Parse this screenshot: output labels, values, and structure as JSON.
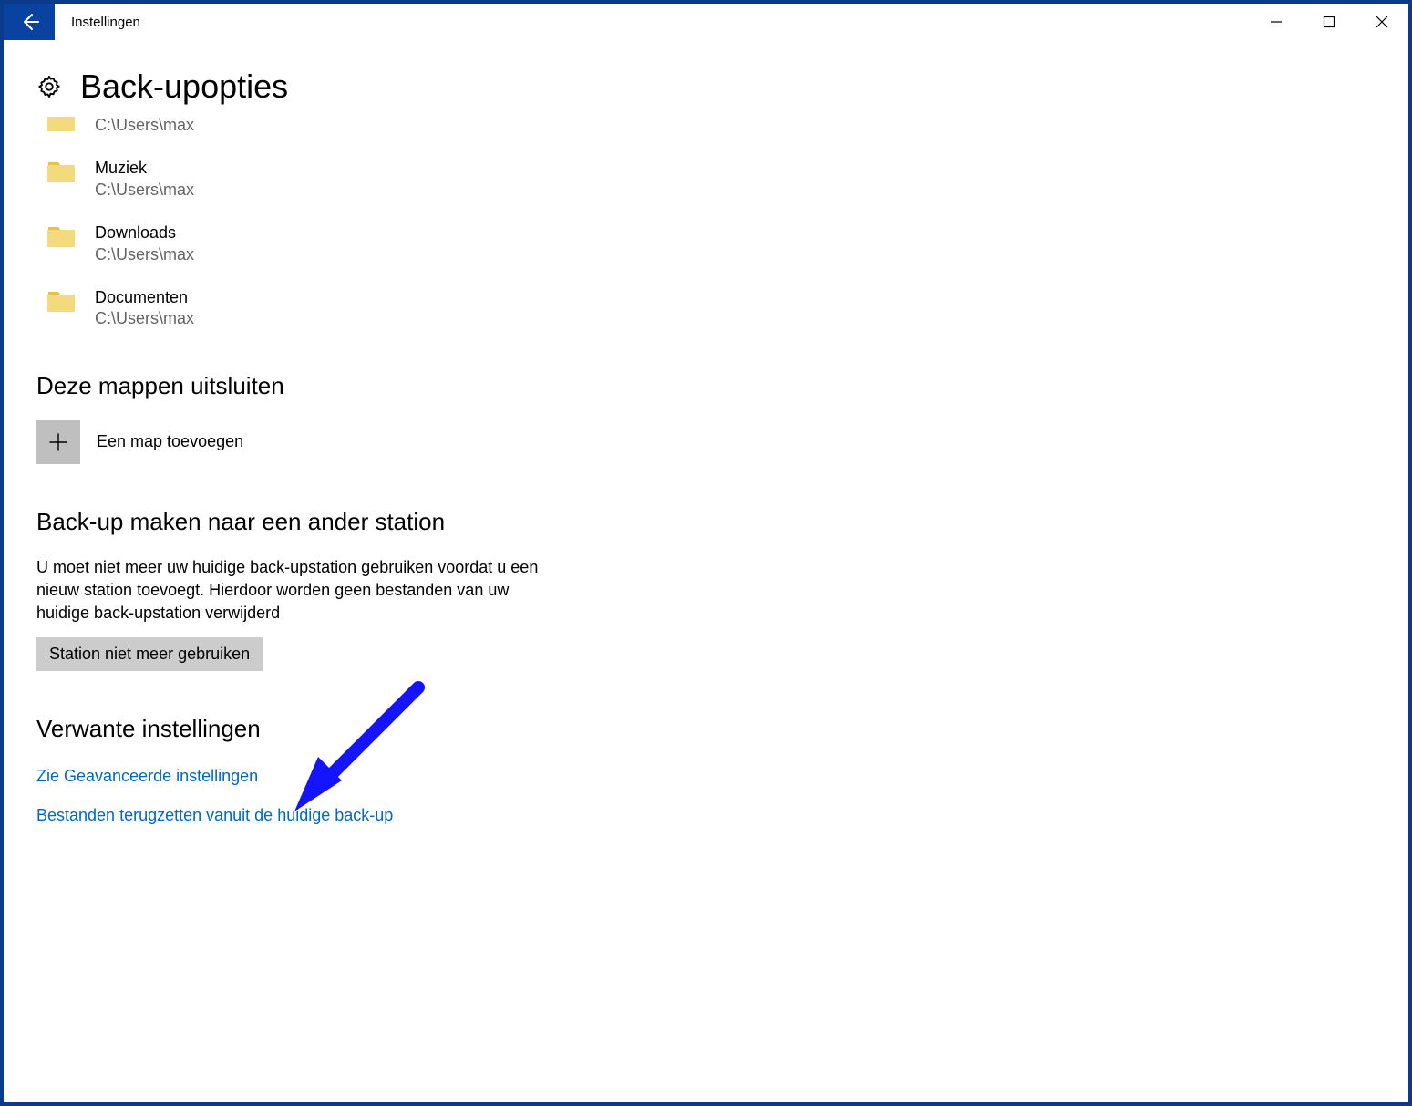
{
  "window": {
    "title": "Instellingen"
  },
  "page": {
    "title": "Back-upopties"
  },
  "folders": [
    {
      "name": "",
      "path": "C:\\Users\\max"
    },
    {
      "name": "Muziek",
      "path": "C:\\Users\\max"
    },
    {
      "name": "Downloads",
      "path": "C:\\Users\\max"
    },
    {
      "name": "Documenten",
      "path": "C:\\Users\\max"
    }
  ],
  "exclude": {
    "heading": "Deze mappen uitsluiten",
    "addLabel": "Een map toevoegen"
  },
  "otherDrive": {
    "heading": "Back-up maken naar een ander station",
    "description": "U moet niet meer uw huidige back-upstation gebruiken voordat u een nieuw station toevoegt. Hierdoor worden geen bestanden van uw huidige back-upstation verwijderd",
    "button": "Station niet meer gebruiken"
  },
  "related": {
    "heading": "Verwante instellingen",
    "link1": "Zie Geavanceerde instellingen",
    "link2": "Bestanden terugzetten vanuit de huidige back-up"
  }
}
